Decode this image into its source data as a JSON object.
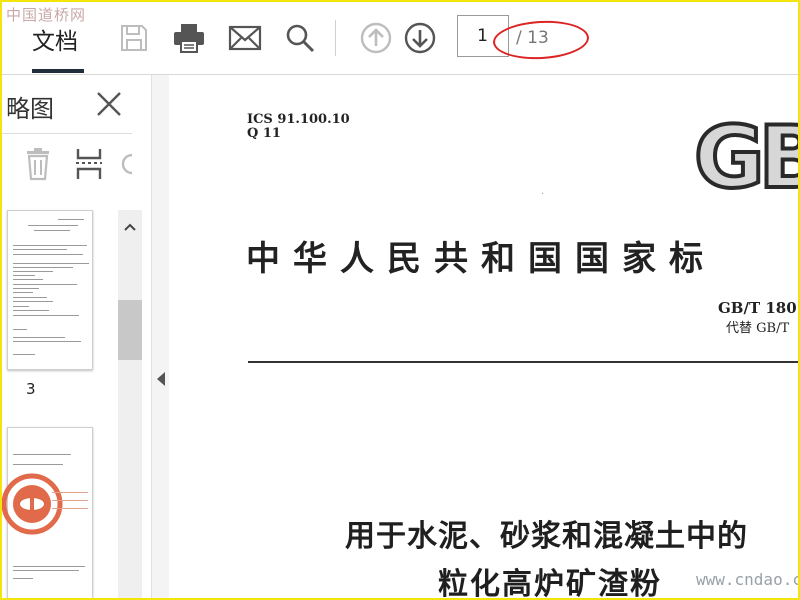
{
  "watermark": "中国道桥网",
  "site_mark": "www.cndao.com",
  "toolbar": {
    "tab_label": "文档",
    "page_current": "1",
    "page_total": "/ 13",
    "icons": [
      "save-icon",
      "print-icon",
      "email-icon",
      "search-icon",
      "arrow-up-icon",
      "arrow-down-icon"
    ],
    "annotation_color": "#dd2424"
  },
  "sidebar": {
    "title": "略图",
    "page_labels": [
      "3"
    ],
    "icons": [
      "trash-icon",
      "extract-pages-icon",
      "rotate-icon",
      "close-icon"
    ]
  },
  "document": {
    "ics": "ICS 91.100.10",
    "classification": "Q 11",
    "logo_text": "GB",
    "gov_title": "中华人民共和国国家标",
    "std_number": "GB/T 180",
    "replaces": "代替 GB/T",
    "title_line1": "用于水泥、砂浆和混凝土中的",
    "title_line2": "粒化高炉矿渣粉"
  },
  "colors": {
    "frame": "#f4e40b",
    "toolbar_icon": "#555555",
    "disabled_icon": "#bdbdbd"
  }
}
